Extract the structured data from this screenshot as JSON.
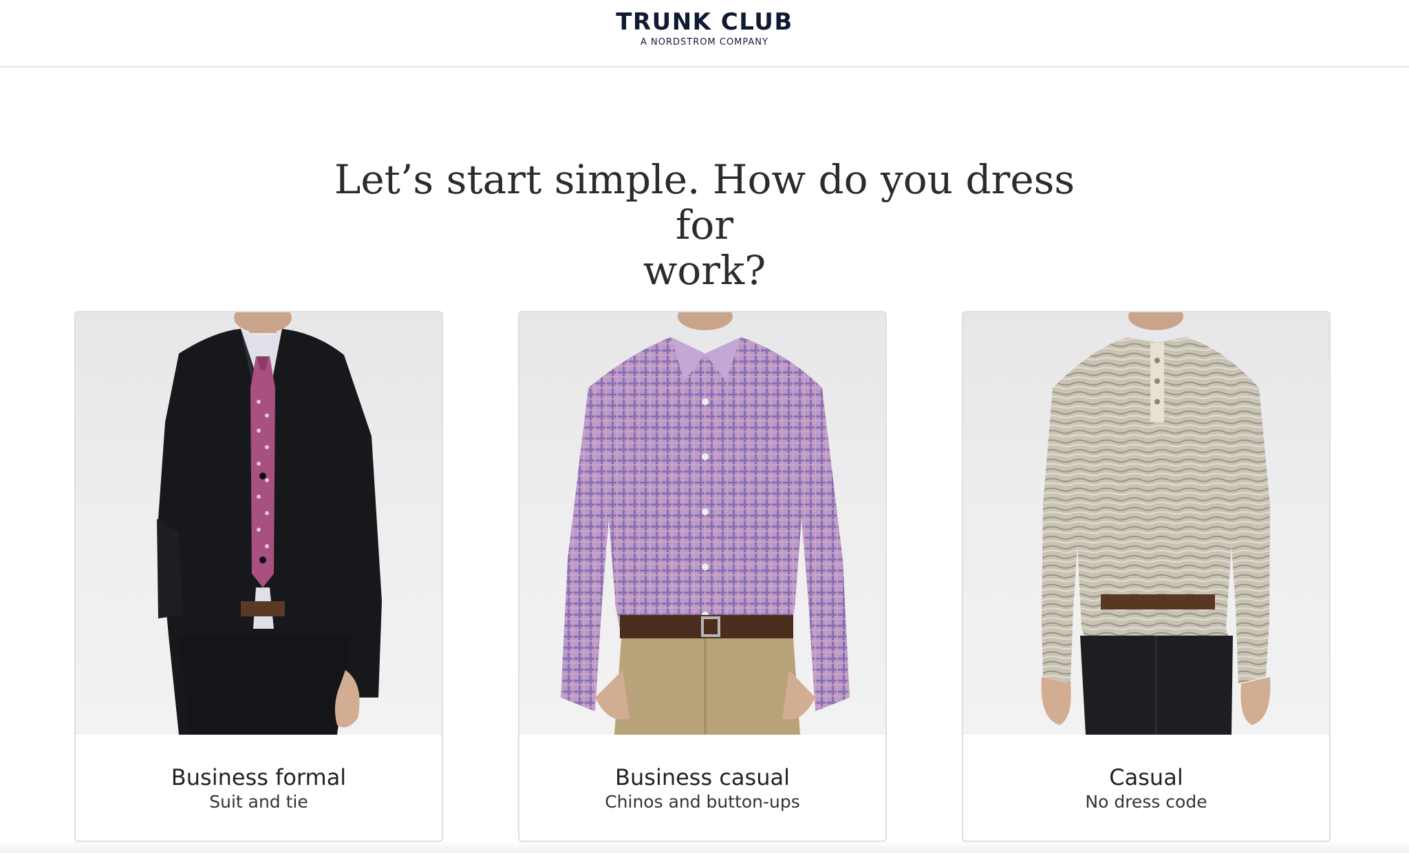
{
  "header": {
    "brand": "TRUNK CLUB",
    "tagline": "A NORDSTROM COMPANY"
  },
  "question": {
    "line1": "Let’s start simple. How do you dress for",
    "line2": "work?"
  },
  "options": [
    {
      "title": "Business formal",
      "subtitle": "Suit and tie",
      "image": "man-in-black-suit-and-pink-tie"
    },
    {
      "title": "Business casual",
      "subtitle": "Chinos and button-ups",
      "image": "man-in-plaid-shirt-and-khaki-chinos"
    },
    {
      "title": "Casual",
      "subtitle": "No dress code",
      "image": "man-in-henley-and-dark-jeans"
    }
  ],
  "colors": {
    "brand": "#0f1a33",
    "card_border": "#dedede",
    "photo_bg": "#ececee"
  }
}
